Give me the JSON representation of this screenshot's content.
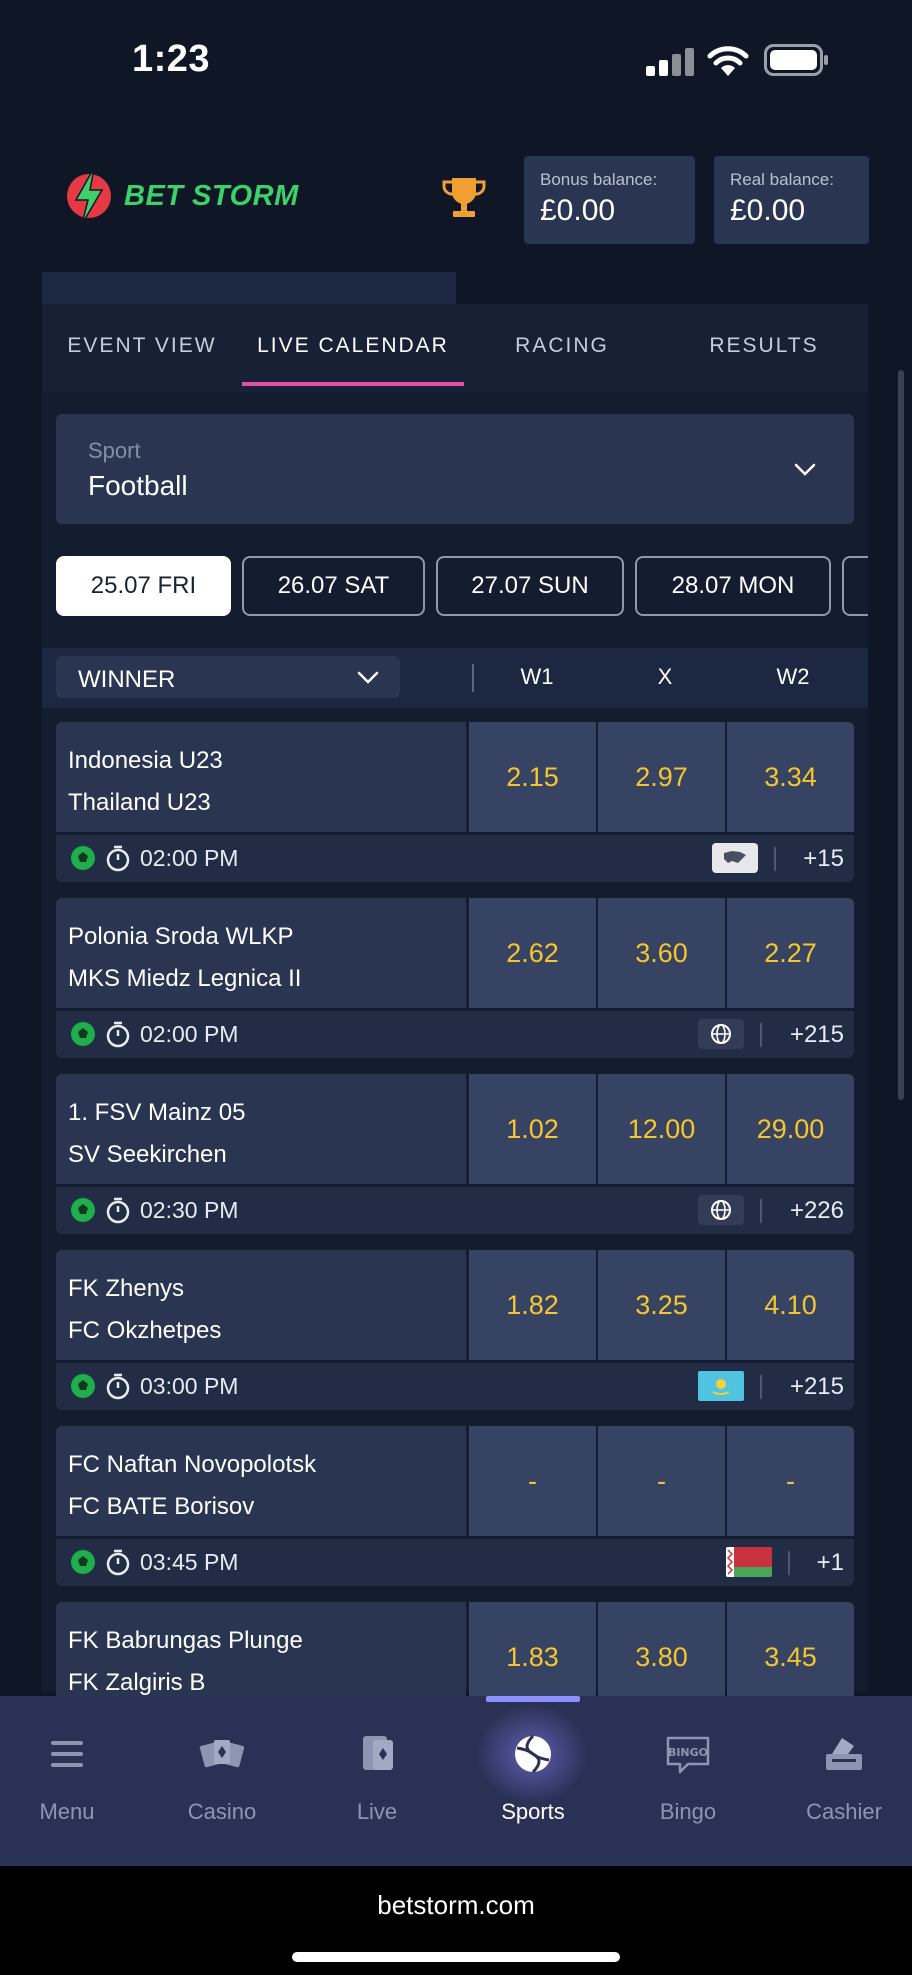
{
  "status": {
    "time": "1:23"
  },
  "brand": {
    "name": "BET STORM"
  },
  "balances": {
    "bonus_label": "Bonus balance:",
    "bonus_value": "£0.00",
    "real_label": "Real balance:",
    "real_value": "£0.00"
  },
  "tabs": [
    {
      "label": "EVENT VIEW"
    },
    {
      "label": "LIVE CALENDAR"
    },
    {
      "label": "RACING"
    },
    {
      "label": "RESULTS"
    }
  ],
  "sport_select": {
    "label": "Sport",
    "value": "Football"
  },
  "dates": [
    "25.07 FRI",
    "26.07 SAT",
    "27.07 SUN",
    "28.07 MON"
  ],
  "market": {
    "selected": "WINNER",
    "col_w1": "W1",
    "col_x": "X",
    "col_w2": "W2"
  },
  "matches": [
    {
      "home": "Indonesia U23",
      "away": "Thailand U23",
      "w1": "2.15",
      "x": "2.97",
      "w2": "3.34",
      "time": "02:00 PM",
      "more": "+15",
      "region_icon": "asia-map-icon"
    },
    {
      "home": "Polonia Sroda WLKP",
      "away": "MKS Miedz Legnica II",
      "w1": "2.62",
      "x": "3.60",
      "w2": "2.27",
      "time": "02:00 PM",
      "more": "+215",
      "region_icon": "globe-icon"
    },
    {
      "home": "1. FSV Mainz 05",
      "away": "SV Seekirchen",
      "w1": "1.02",
      "x": "12.00",
      "w2": "29.00",
      "time": "02:30 PM",
      "more": "+226",
      "region_icon": "globe-icon"
    },
    {
      "home": "FK Zhenys",
      "away": "FC Okzhetpes",
      "w1": "1.82",
      "x": "3.25",
      "w2": "4.10",
      "time": "03:00 PM",
      "more": "+215",
      "region_icon": "kazakhstan-flag-icon"
    },
    {
      "home": "FC Naftan Novopolotsk",
      "away": "FC BATE Borisov",
      "w1": "-",
      "x": "-",
      "w2": "-",
      "time": "03:45 PM",
      "more": "+1",
      "region_icon": "belarus-flag-icon"
    },
    {
      "home": "FK Babrungas Plunge",
      "away": "FK Zalgiris B",
      "w1": "1.83",
      "x": "3.80",
      "w2": "3.45"
    }
  ],
  "nav": [
    {
      "label": "Menu",
      "icon": "menu-icon"
    },
    {
      "label": "Casino",
      "icon": "casino-icon"
    },
    {
      "label": "Live",
      "icon": "live-cards-icon"
    },
    {
      "label": "Sports",
      "icon": "football-icon"
    },
    {
      "label": "Bingo",
      "icon": "bingo-icon"
    },
    {
      "label": "Cashier",
      "icon": "cashier-icon"
    }
  ],
  "browser": {
    "url": "betstorm.com"
  },
  "colors": {
    "accent_tab": "#e24fa6",
    "odds": "#f5c62e",
    "brand_green": "#3dd16a",
    "nav_active": "#8f90ff"
  }
}
